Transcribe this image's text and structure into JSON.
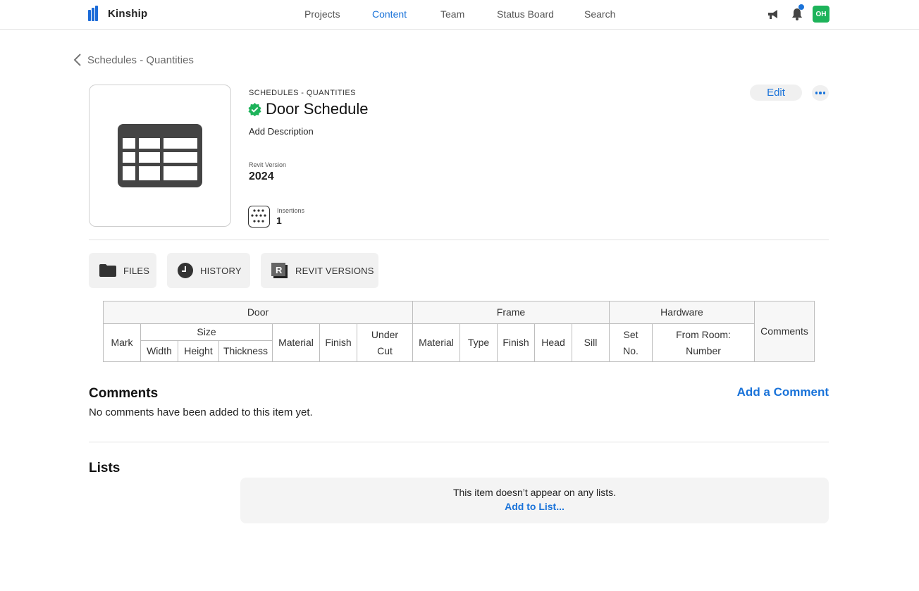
{
  "app": {
    "brand": "Kinship",
    "brand_color": "#1b6bd8",
    "accent_color": "#1a73d9"
  },
  "nav": {
    "items": [
      {
        "label": "Projects",
        "active": false
      },
      {
        "label": "Content",
        "active": true
      },
      {
        "label": "Team",
        "active": false
      },
      {
        "label": "Status Board",
        "active": false
      },
      {
        "label": "Search",
        "active": false
      }
    ]
  },
  "topbar": {
    "icons": [
      "megaphone-icon",
      "bell-icon"
    ],
    "notification_indicator": true,
    "avatar_initials": "OH",
    "avatar_color": "#1db35a"
  },
  "breadcrumb": {
    "label": "Schedules - Quantities"
  },
  "item": {
    "category": "SCHEDULES - QUANTITIES",
    "title": "Door Schedule",
    "verified": true,
    "add_description": "Add Description",
    "revit_version_label": "Revit Version",
    "revit_version": "2024",
    "insertions_label": "Insertions",
    "insertions": "1",
    "edit_label": "Edit",
    "thumbnail_icon": "table-icon"
  },
  "tabs": [
    {
      "label": "FILES",
      "icon": "folder-icon"
    },
    {
      "label": "HISTORY",
      "icon": "clock-icon"
    },
    {
      "label": "REVIT VERSIONS",
      "icon": "revit-icon"
    }
  ],
  "schedule": {
    "groups": [
      "Door",
      "Frame",
      "Hardware"
    ],
    "comments": "Comments",
    "door": {
      "mark": "Mark",
      "size": "Size",
      "width": "Width",
      "height": "Height",
      "thickness": "Thickness",
      "material": "Material",
      "finish": "Finish",
      "undercut_1": "Under",
      "undercut_2": "Cut"
    },
    "frame": {
      "material": "Material",
      "type": "Type",
      "finish": "Finish",
      "head": "Head",
      "sill": "Sill"
    },
    "hardware": {
      "set_1": "Set",
      "set_2": "No.",
      "room_1": "From Room:",
      "room_2": "Number"
    }
  },
  "comments": {
    "title": "Comments",
    "add_label": "Add a Comment",
    "empty_text": "No comments have been added to this item yet."
  },
  "lists": {
    "title": "Lists",
    "empty_text": "This item doesn’t appear on any lists.",
    "add_label": "Add to List..."
  }
}
